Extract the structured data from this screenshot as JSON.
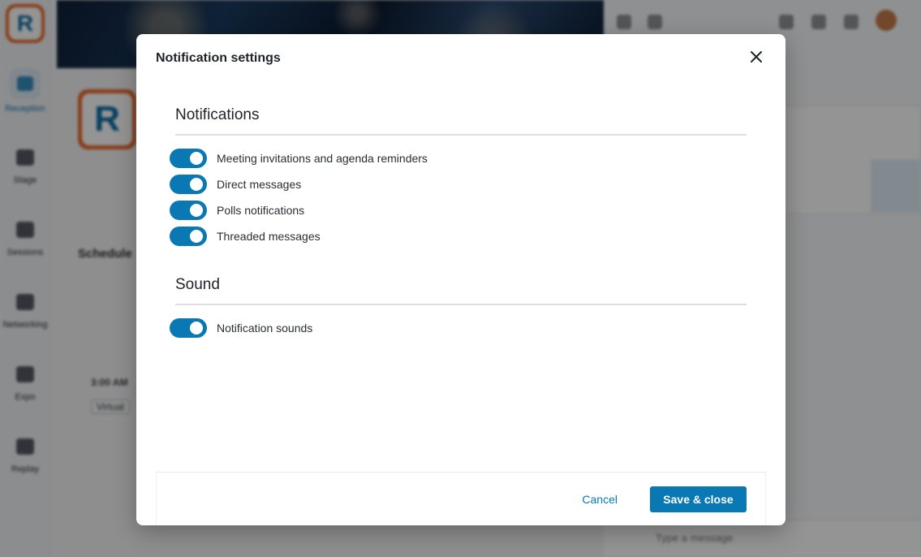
{
  "background": {
    "sidebar": {
      "items": [
        {
          "label": "Reception",
          "icon": "home-icon"
        },
        {
          "label": "Stage",
          "icon": "video-icon"
        },
        {
          "label": "Sessions",
          "icon": "sessions-icon"
        },
        {
          "label": "Networking",
          "icon": "handshake-icon"
        },
        {
          "label": "Expo",
          "icon": "store-icon"
        },
        {
          "label": "Replay",
          "icon": "replay-icon"
        }
      ]
    },
    "schedule_label": "Schedule",
    "time_label": "3:00 AM",
    "tag_label": "Virtual",
    "message_placeholder": "Type a message"
  },
  "modal": {
    "title": "Notification settings",
    "close_icon": "close-icon",
    "sections": [
      {
        "title": "Notifications",
        "toggles": [
          {
            "label": "Meeting invitations and agenda reminders",
            "on": true
          },
          {
            "label": "Direct messages",
            "on": true
          },
          {
            "label": "Polls notifications",
            "on": true
          },
          {
            "label": "Threaded messages",
            "on": true
          }
        ]
      },
      {
        "title": "Sound",
        "toggles": [
          {
            "label": "Notification sounds",
            "on": true
          }
        ]
      }
    ],
    "footer": {
      "cancel_label": "Cancel",
      "save_label": "Save & close"
    }
  },
  "colors": {
    "accent": "#0a78b2",
    "brand_orange": "#e9692c"
  }
}
